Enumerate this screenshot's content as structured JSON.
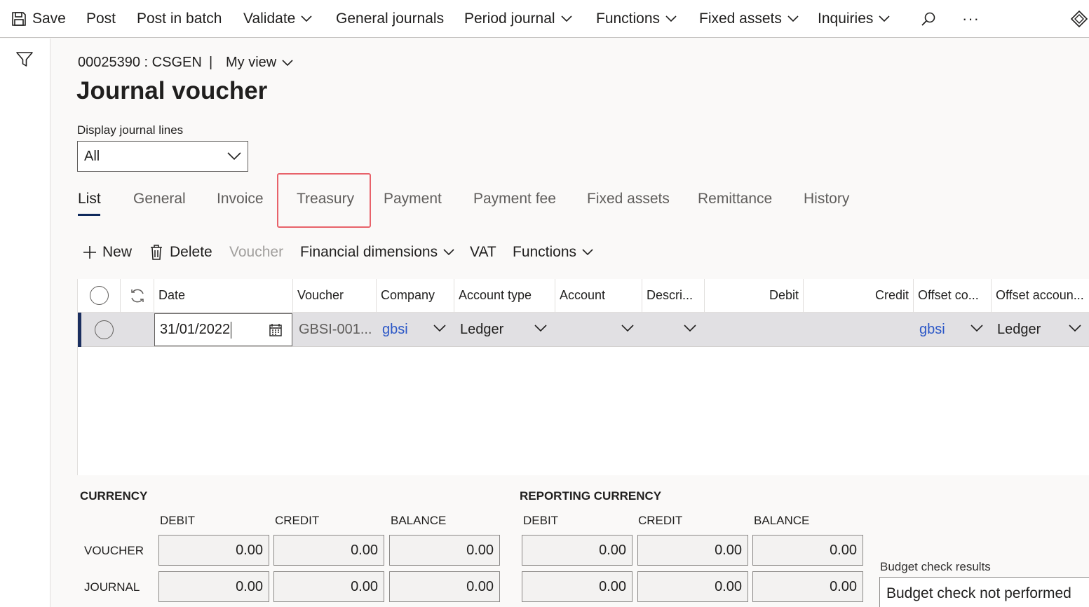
{
  "toolbar": {
    "save": "Save",
    "post": "Post",
    "post_in_batch": "Post in batch",
    "validate": "Validate",
    "general_journals": "General journals",
    "period_journal": "Period journal",
    "functions": "Functions",
    "fixed_assets": "Fixed assets",
    "inquiries": "Inquiries",
    "more": "···"
  },
  "header": {
    "breadcrumb": "00025390 : CSGEN",
    "separator": "|",
    "view": "My view",
    "title": "Journal voucher"
  },
  "display_lines": {
    "label": "Display journal lines",
    "value": "All"
  },
  "tabs": [
    "List",
    "General",
    "Invoice",
    "Treasury",
    "Payment",
    "Payment fee",
    "Fixed assets",
    "Remittance",
    "History"
  ],
  "actions": {
    "new": "New",
    "delete": "Delete",
    "voucher": "Voucher",
    "financial_dimensions": "Financial dimensions",
    "vat": "VAT",
    "functions": "Functions"
  },
  "grid": {
    "columns": [
      "Date",
      "Voucher",
      "Company",
      "Account type",
      "Account",
      "Descri...",
      "Debit",
      "Credit",
      "Offset co...",
      "Offset accoun..."
    ],
    "row": {
      "date": "31/01/2022",
      "voucher": "GBSI-001...",
      "company": "gbsi",
      "account_type": "Ledger",
      "account": "",
      "description": "",
      "debit": "",
      "credit": "",
      "offset_company": "gbsi",
      "offset_account_type": "Ledger"
    }
  },
  "totals": {
    "currency_title": "CURRENCY",
    "reporting_title": "REPORTING CURRENCY",
    "debit": "DEBIT",
    "credit": "CREDIT",
    "balance": "BALANCE",
    "voucher_label": "VOUCHER",
    "journal_label": "JOURNAL",
    "currency": {
      "voucher": {
        "debit": "0.00",
        "credit": "0.00",
        "balance": "0.00"
      },
      "journal": {
        "debit": "0.00",
        "credit": "0.00",
        "balance": "0.00"
      }
    },
    "reporting": {
      "voucher": {
        "debit": "0.00",
        "credit": "0.00",
        "balance": "0.00"
      },
      "journal": {
        "debit": "0.00",
        "credit": "0.00",
        "balance": "0.00"
      }
    }
  },
  "budget": {
    "label": "Budget check results",
    "value": "Budget check not performed"
  },
  "colors": {
    "accent": "#0f2a5c",
    "link": "#2b57c7",
    "highlight": "#e8626a"
  }
}
